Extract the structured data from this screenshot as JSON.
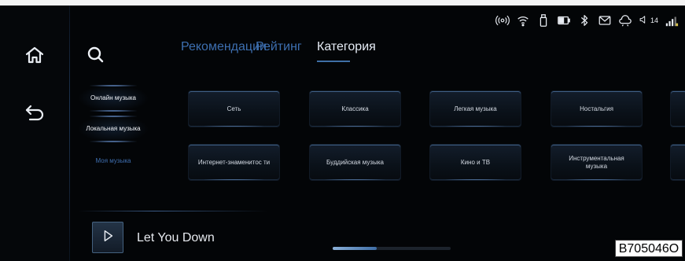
{
  "tabs": {
    "recommendations": "Рекомендации",
    "rating": "Рейтинг",
    "category": "Категория"
  },
  "side_nav": {
    "online": "Онлайн музыка",
    "local": "Локальная музыка",
    "my": "Моя музыка"
  },
  "categories": {
    "row1": [
      "Сеть",
      "Классика",
      "Легкая музыка",
      "Ностальгия"
    ],
    "row2": [
      "Интернет-знаменитос ти",
      "Буддийская музыка",
      "Кино и ТВ",
      "Инструментальная музыка"
    ]
  },
  "status": {
    "volume_level": "14"
  },
  "player": {
    "song_title": "Let You Down",
    "progress_fraction": 0.37
  },
  "watermark": "B705046O",
  "colors": {
    "accent": "#3f6fa6",
    "active_text": "#e6ecf5",
    "dim_text": "#3d6fb0",
    "background": "#030507"
  },
  "icons": {
    "home": "home-icon",
    "back": "back-icon",
    "search": "search-icon",
    "hotspot": "hotspot-icon",
    "wifi": "wifi-icon",
    "usb": "usb-drive-icon",
    "card": "sd-card-icon",
    "bluetooth": "bluetooth-icon",
    "mail": "mail-icon",
    "cloud": "cloud-icon",
    "volume": "volume-icon",
    "signal": "signal-icon",
    "play": "play-icon"
  }
}
